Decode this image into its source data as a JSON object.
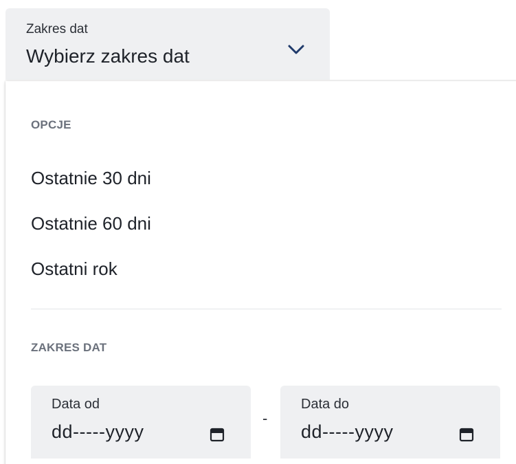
{
  "date_range_select": {
    "label": "Zakres dat",
    "value": "Wybierz zakres dat",
    "icon": "chevron-down-icon"
  },
  "dropdown": {
    "options_heading": "OPCJE",
    "options": [
      {
        "label": "Ostatnie 30 dni"
      },
      {
        "label": "Ostatnie 60 dni"
      },
      {
        "label": "Ostatni rok"
      }
    ],
    "range_heading": "ZAKRES DAT",
    "date_from": {
      "label": "Data od",
      "value": "dd-----yyyy",
      "icon": "calendar-icon"
    },
    "separator": "-",
    "date_to": {
      "label": "Data do",
      "value": "dd-----yyyy",
      "icon": "calendar-icon"
    }
  },
  "colors": {
    "field_background": "#eff0f2",
    "chevron": "#1f3a6b",
    "heading_text": "#6b717c",
    "body_text": "#1e2229"
  }
}
